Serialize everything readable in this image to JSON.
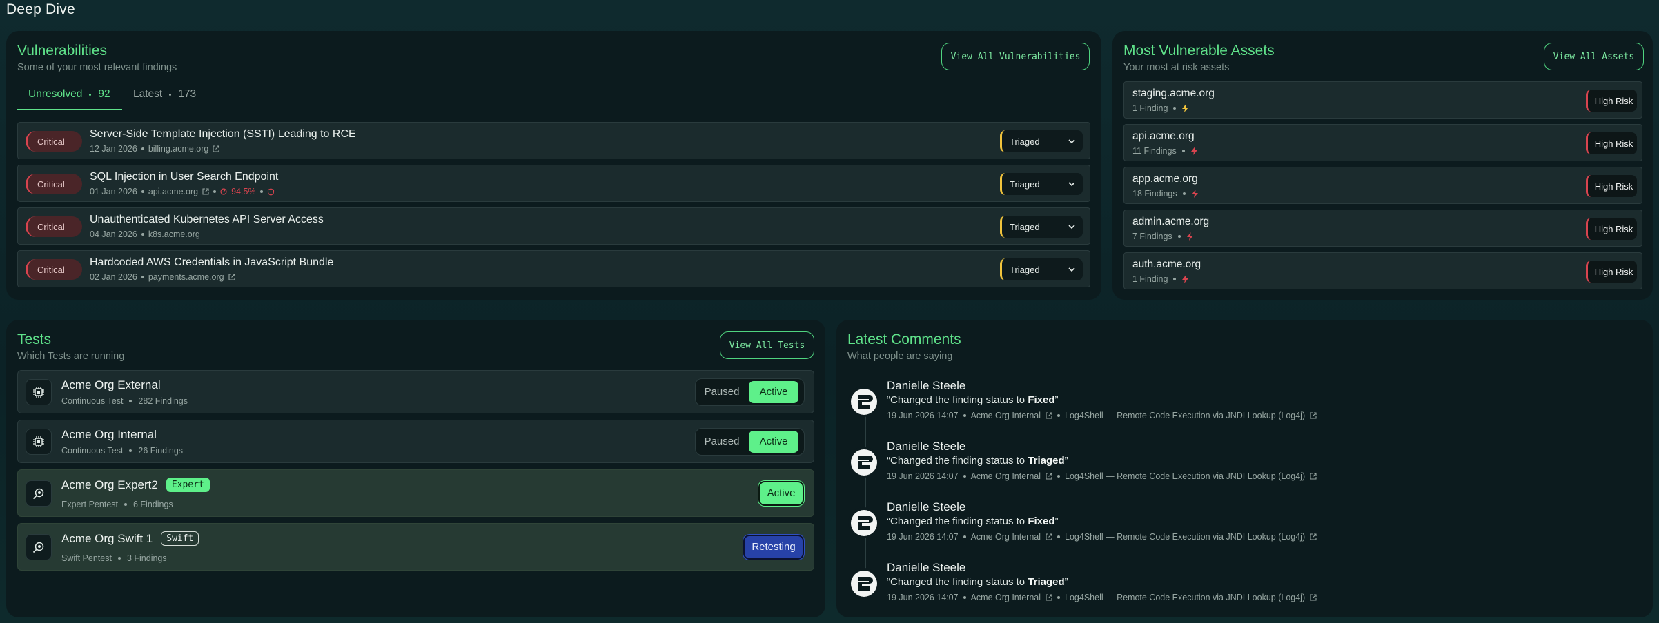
{
  "page": {
    "title": "Deep Dive"
  },
  "vulnerabilities": {
    "title": "Vulnerabilities",
    "subtitle": "Some of your most relevant findings",
    "view_all": "View All Vulnerabilities",
    "tabs": [
      {
        "label": "Unresolved",
        "count": "92"
      },
      {
        "label": "Latest",
        "count": "173"
      }
    ],
    "rows": [
      {
        "severity": "Critical",
        "title": "Server-Side Template Injection (SSTI) Leading to RCE",
        "date": "12 Jan 2026",
        "host": "billing.acme.org",
        "status": "Triaged"
      },
      {
        "severity": "Critical",
        "title": "SQL Injection in User Search Endpoint",
        "date": "01 Jan 2026",
        "host": "api.acme.org",
        "epss": "94.5%",
        "status": "Triaged"
      },
      {
        "severity": "Critical",
        "title": "Unauthenticated Kubernetes API Server Access",
        "date": "04 Jan 2026",
        "host": "k8s.acme.org",
        "status": "Triaged"
      },
      {
        "severity": "Critical",
        "title": "Hardcoded AWS Credentials in JavaScript Bundle",
        "date": "02 Jan 2026",
        "host": "payments.acme.org",
        "status": "Triaged"
      }
    ]
  },
  "assets": {
    "title": "Most Vulnerable Assets",
    "subtitle": "Your most at risk assets",
    "view_all": "View All Assets",
    "rows": [
      {
        "name": "staging.acme.org",
        "findings": "1 Finding",
        "icon": "lightning-icon",
        "risk": "High Risk"
      },
      {
        "name": "api.acme.org",
        "findings": "11 Findings",
        "icon": "bolt-red-icon",
        "risk": "High Risk"
      },
      {
        "name": "app.acme.org",
        "findings": "18 Findings",
        "icon": "bolt-red-icon",
        "risk": "High Risk"
      },
      {
        "name": "admin.acme.org",
        "findings": "7 Findings",
        "icon": "bolt-red-icon",
        "risk": "High Risk"
      },
      {
        "name": "auth.acme.org",
        "findings": "1 Finding",
        "icon": "bolt-red-icon",
        "risk": "High Risk"
      }
    ]
  },
  "tests": {
    "title": "Tests",
    "subtitle": "Which Tests are running",
    "view_all": "View All Tests",
    "rows": [
      {
        "name": "Acme Org External",
        "type": "Continuous Test",
        "findings": "282 Findings",
        "paused": "Paused",
        "active": "Active"
      },
      {
        "name": "Acme Org Internal",
        "type": "Continuous Test",
        "findings": "26 Findings",
        "paused": "Paused",
        "active": "Active"
      },
      {
        "name": "Acme Org Expert2",
        "chip": "Expert",
        "type": "Expert Pentest",
        "findings": "6 Findings",
        "status": "Active"
      },
      {
        "name": "Acme Org Swift 1",
        "chip": "Swift",
        "type": "Swift Pentest",
        "findings": "3 Findings",
        "status": "Retesting"
      }
    ]
  },
  "comments": {
    "title": "Latest Comments",
    "subtitle": "What people are saying",
    "items": [
      {
        "author": "Danielle Steele",
        "prefix": "“Changed the finding status to ",
        "status": "Fixed",
        "suffix": "”",
        "time": "19 Jun 2026 14:07",
        "test": "Acme Org Internal",
        "finding": "Log4Shell — Remote Code Execution via JNDI Lookup (Log4j)"
      },
      {
        "author": "Danielle Steele",
        "prefix": "“Changed the finding status to ",
        "status": "Triaged",
        "suffix": "”",
        "time": "19 Jun 2026 14:07",
        "test": "Acme Org Internal",
        "finding": "Log4Shell — Remote Code Execution via JNDI Lookup (Log4j)"
      },
      {
        "author": "Danielle Steele",
        "prefix": "“Changed the finding status to ",
        "status": "Fixed",
        "suffix": "”",
        "time": "19 Jun 2026 14:07",
        "test": "Acme Org Internal",
        "finding": "Log4Shell — Remote Code Execution via JNDI Lookup (Log4j)"
      },
      {
        "author": "Danielle Steele",
        "prefix": "“Changed the finding status to ",
        "status": "Triaged",
        "suffix": "”",
        "time": "19 Jun 2026 14:07",
        "test": "Acme Org Internal",
        "finding": "Log4Shell — Remote Code Execution via JNDI Lookup (Log4j)"
      }
    ]
  },
  "colors": {
    "accent": "#5fe28a",
    "critical": "#d8444f",
    "triaged": "#f0c33c",
    "retesting": "#2742a8"
  }
}
